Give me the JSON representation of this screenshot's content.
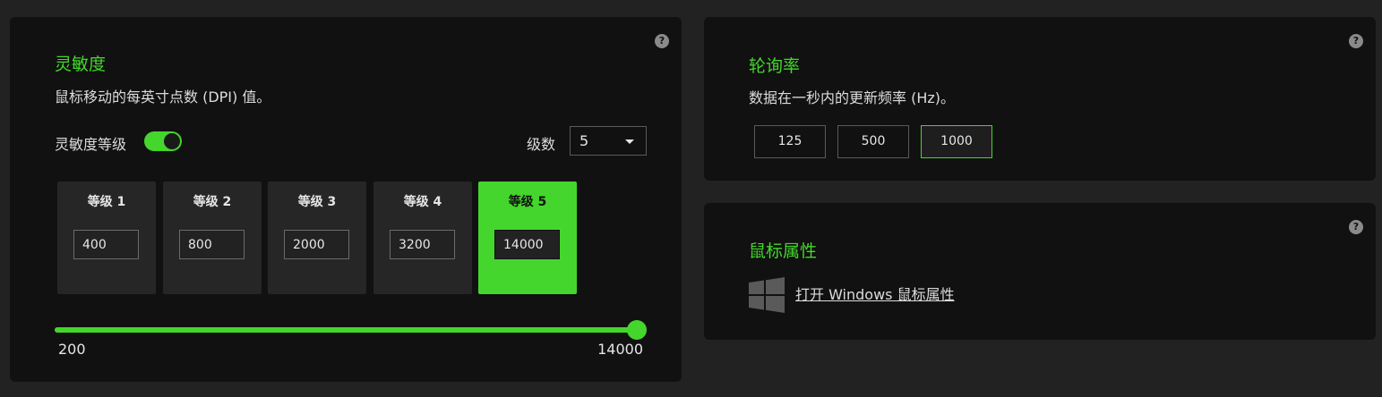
{
  "sensitivity": {
    "help": "?",
    "title": "灵敏度",
    "description": "鼠标移动的每英寸点数 (DPI) 值。",
    "stages_label": "灵敏度等级",
    "stages_enabled": true,
    "count_label": "级数",
    "count_value": "5",
    "levels": [
      {
        "label": "等级 1",
        "value": "400"
      },
      {
        "label": "等级 2",
        "value": "800"
      },
      {
        "label": "等级 3",
        "value": "2000"
      },
      {
        "label": "等级 4",
        "value": "3200"
      },
      {
        "label": "等级 5",
        "value": "14000"
      }
    ],
    "active_level": 4,
    "slider": {
      "min": 200,
      "max": 14000,
      "value": 14000,
      "min_label": "200",
      "max_label": "14000"
    }
  },
  "polling": {
    "help": "?",
    "title": "轮询率",
    "description": "数据在一秒内的更新频率 (Hz)。",
    "options": [
      "125",
      "500",
      "1000"
    ],
    "selected": "1000"
  },
  "mouse_props": {
    "help": "?",
    "title": "鼠标属性",
    "link": "打开 Windows 鼠标属性",
    "icon": "windows-logo-icon"
  },
  "colors": {
    "accent": "#44d62c",
    "panel": "#111111",
    "background": "#222222"
  }
}
